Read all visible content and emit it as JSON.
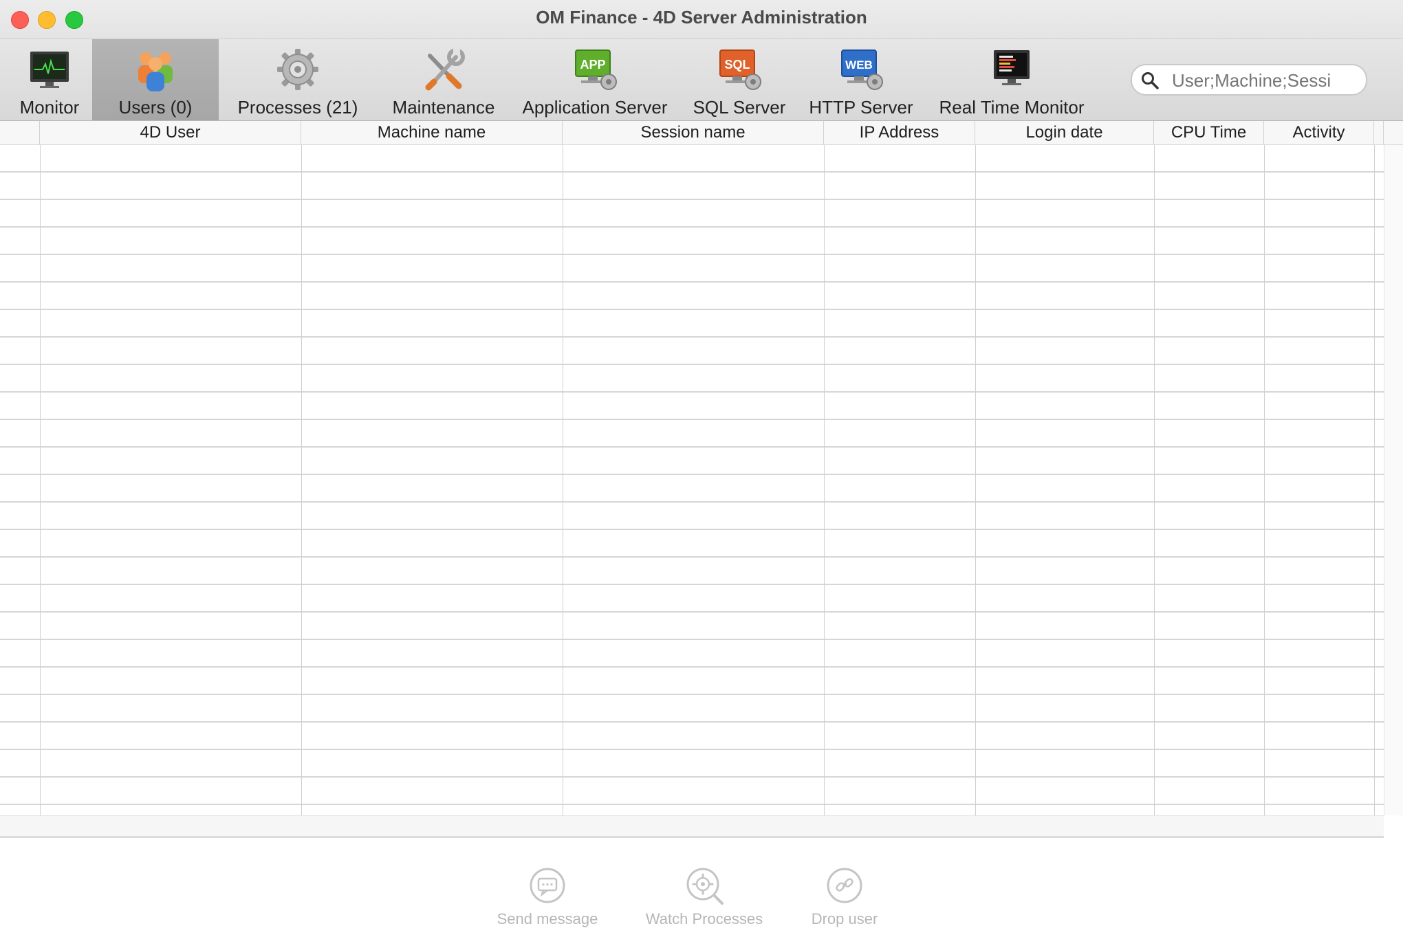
{
  "window": {
    "title": "OM Finance - 4D Server Administration"
  },
  "toolbar": {
    "items": [
      {
        "label": "Monitor",
        "icon": "monitor-icon",
        "selected": false
      },
      {
        "label": "Users (0)",
        "icon": "users-icon",
        "selected": true
      },
      {
        "label": "Processes (21)",
        "icon": "gear-icon",
        "selected": false
      },
      {
        "label": "Maintenance",
        "icon": "tools-icon",
        "selected": false
      },
      {
        "label": "Application Server",
        "icon": "app-server-icon",
        "selected": false
      },
      {
        "label": "SQL Server",
        "icon": "sql-server-icon",
        "selected": false
      },
      {
        "label": "HTTP Server",
        "icon": "http-server-icon",
        "selected": false
      },
      {
        "label": "Real Time Monitor",
        "icon": "real-time-monitor-icon",
        "selected": false
      }
    ],
    "search": {
      "value": "",
      "placeholder": "User;Machine;Sessi"
    }
  },
  "table": {
    "columns": [
      "4D User",
      "Machine name",
      "Session name",
      "IP Address",
      "Login date",
      "CPU Time",
      "Activity"
    ],
    "rows": []
  },
  "actions": [
    {
      "label": "Send message",
      "icon": "message-icon",
      "enabled": false
    },
    {
      "label": "Watch Processes",
      "icon": "watch-processes-icon",
      "enabled": false
    },
    {
      "label": "Drop user",
      "icon": "drop-user-icon",
      "enabled": false
    }
  ],
  "colors": {
    "selected_tab": "#aeaeae",
    "disabled_text": "#b6b6b6",
    "grid_line": "#d6d6d6"
  }
}
